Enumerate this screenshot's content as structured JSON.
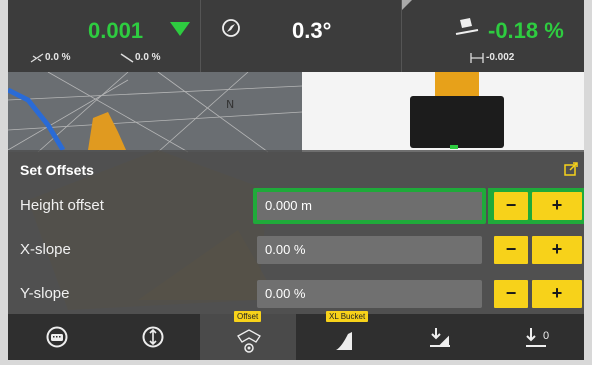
{
  "status": {
    "elevation_value": "0.001",
    "cross_slope": "0.0 %",
    "main_slope": "0.0 %",
    "heading_value": "0.3°",
    "bucket_slope_value": "-0.18 %",
    "bucket_width_value": "-0.002"
  },
  "scene": {
    "compass_label": "N"
  },
  "panel": {
    "title": "Set Offsets",
    "rows": [
      {
        "label": "Height offset",
        "value": "0.000 m",
        "active": true
      },
      {
        "label": "X-slope",
        "value": "0.00 %",
        "active": false
      },
      {
        "label": "Y-slope",
        "value": "0.00 %",
        "active": false
      }
    ],
    "minus_label": "−",
    "plus_label": "+"
  },
  "tabs": {
    "offset_tag": "Offset",
    "bucket_tag": "XL Bucket",
    "zero_label": "0"
  },
  "colors": {
    "accent_green": "#2ecc40",
    "active_outline": "#1faa3a",
    "button_yellow": "#f7d21a"
  }
}
